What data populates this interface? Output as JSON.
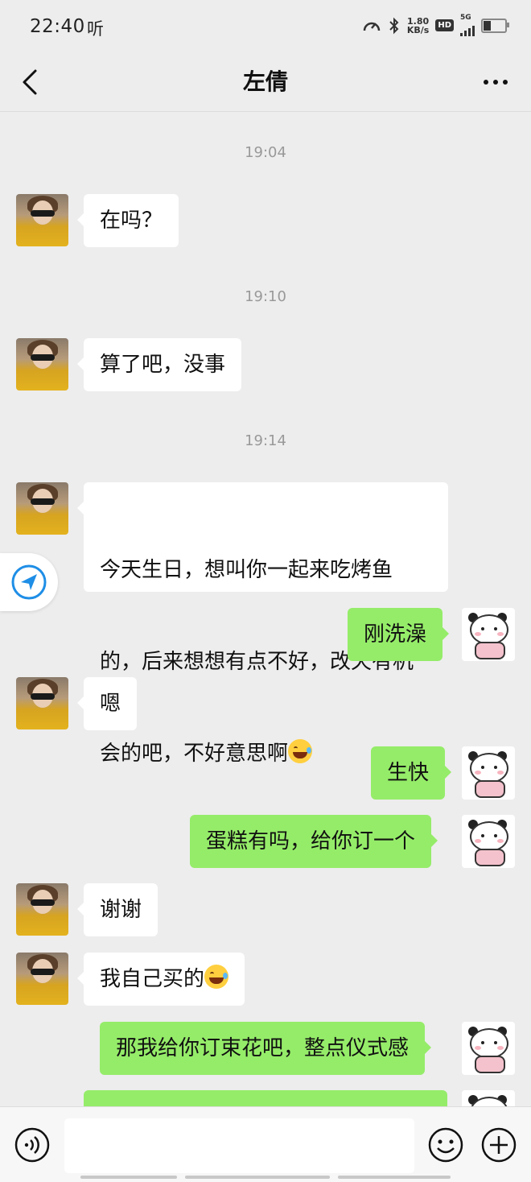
{
  "status_bar": {
    "time": "22:40",
    "listen_label": "听",
    "net_speed_value": "1.80",
    "net_speed_unit": "KB/s",
    "hd_label": "HD",
    "network_label": "5G"
  },
  "header": {
    "title": "左倩"
  },
  "messages": [
    {
      "type": "time",
      "text": "19:04"
    },
    {
      "type": "left",
      "text": "在吗？"
    },
    {
      "type": "time",
      "text": "19:10"
    },
    {
      "type": "left",
      "text": "算了吧，没事"
    },
    {
      "type": "time",
      "text": "19:14"
    },
    {
      "type": "left",
      "lines": [
        "今天生日，想叫你一起来吃烤鱼",
        "的，后来想想有点不好，改天有机",
        "会的吧，不好意思啊"
      ],
      "emoji": "face-with-tears-of-joy"
    },
    {
      "type": "right",
      "text": "刚洗澡"
    },
    {
      "type": "left",
      "text": "嗯"
    },
    {
      "type": "right",
      "text": "生快"
    },
    {
      "type": "right",
      "text": "蛋糕有吗，给你订一个"
    },
    {
      "type": "left",
      "text": "谢谢"
    },
    {
      "type": "left",
      "text": "我自己买的",
      "emoji": "face-with-tears-of-joy"
    },
    {
      "type": "right",
      "text": "那我给你订束花吧，整点仪式感"
    }
  ],
  "input_bar": {
    "placeholder": "",
    "icons": [
      "voice-icon",
      "emoji-icon",
      "plus-icon"
    ]
  },
  "colors": {
    "background": "#ededed",
    "sent_bubble": "#95ec69",
    "received_bubble": "#ffffff",
    "float_accent": "#1e8ee6"
  }
}
